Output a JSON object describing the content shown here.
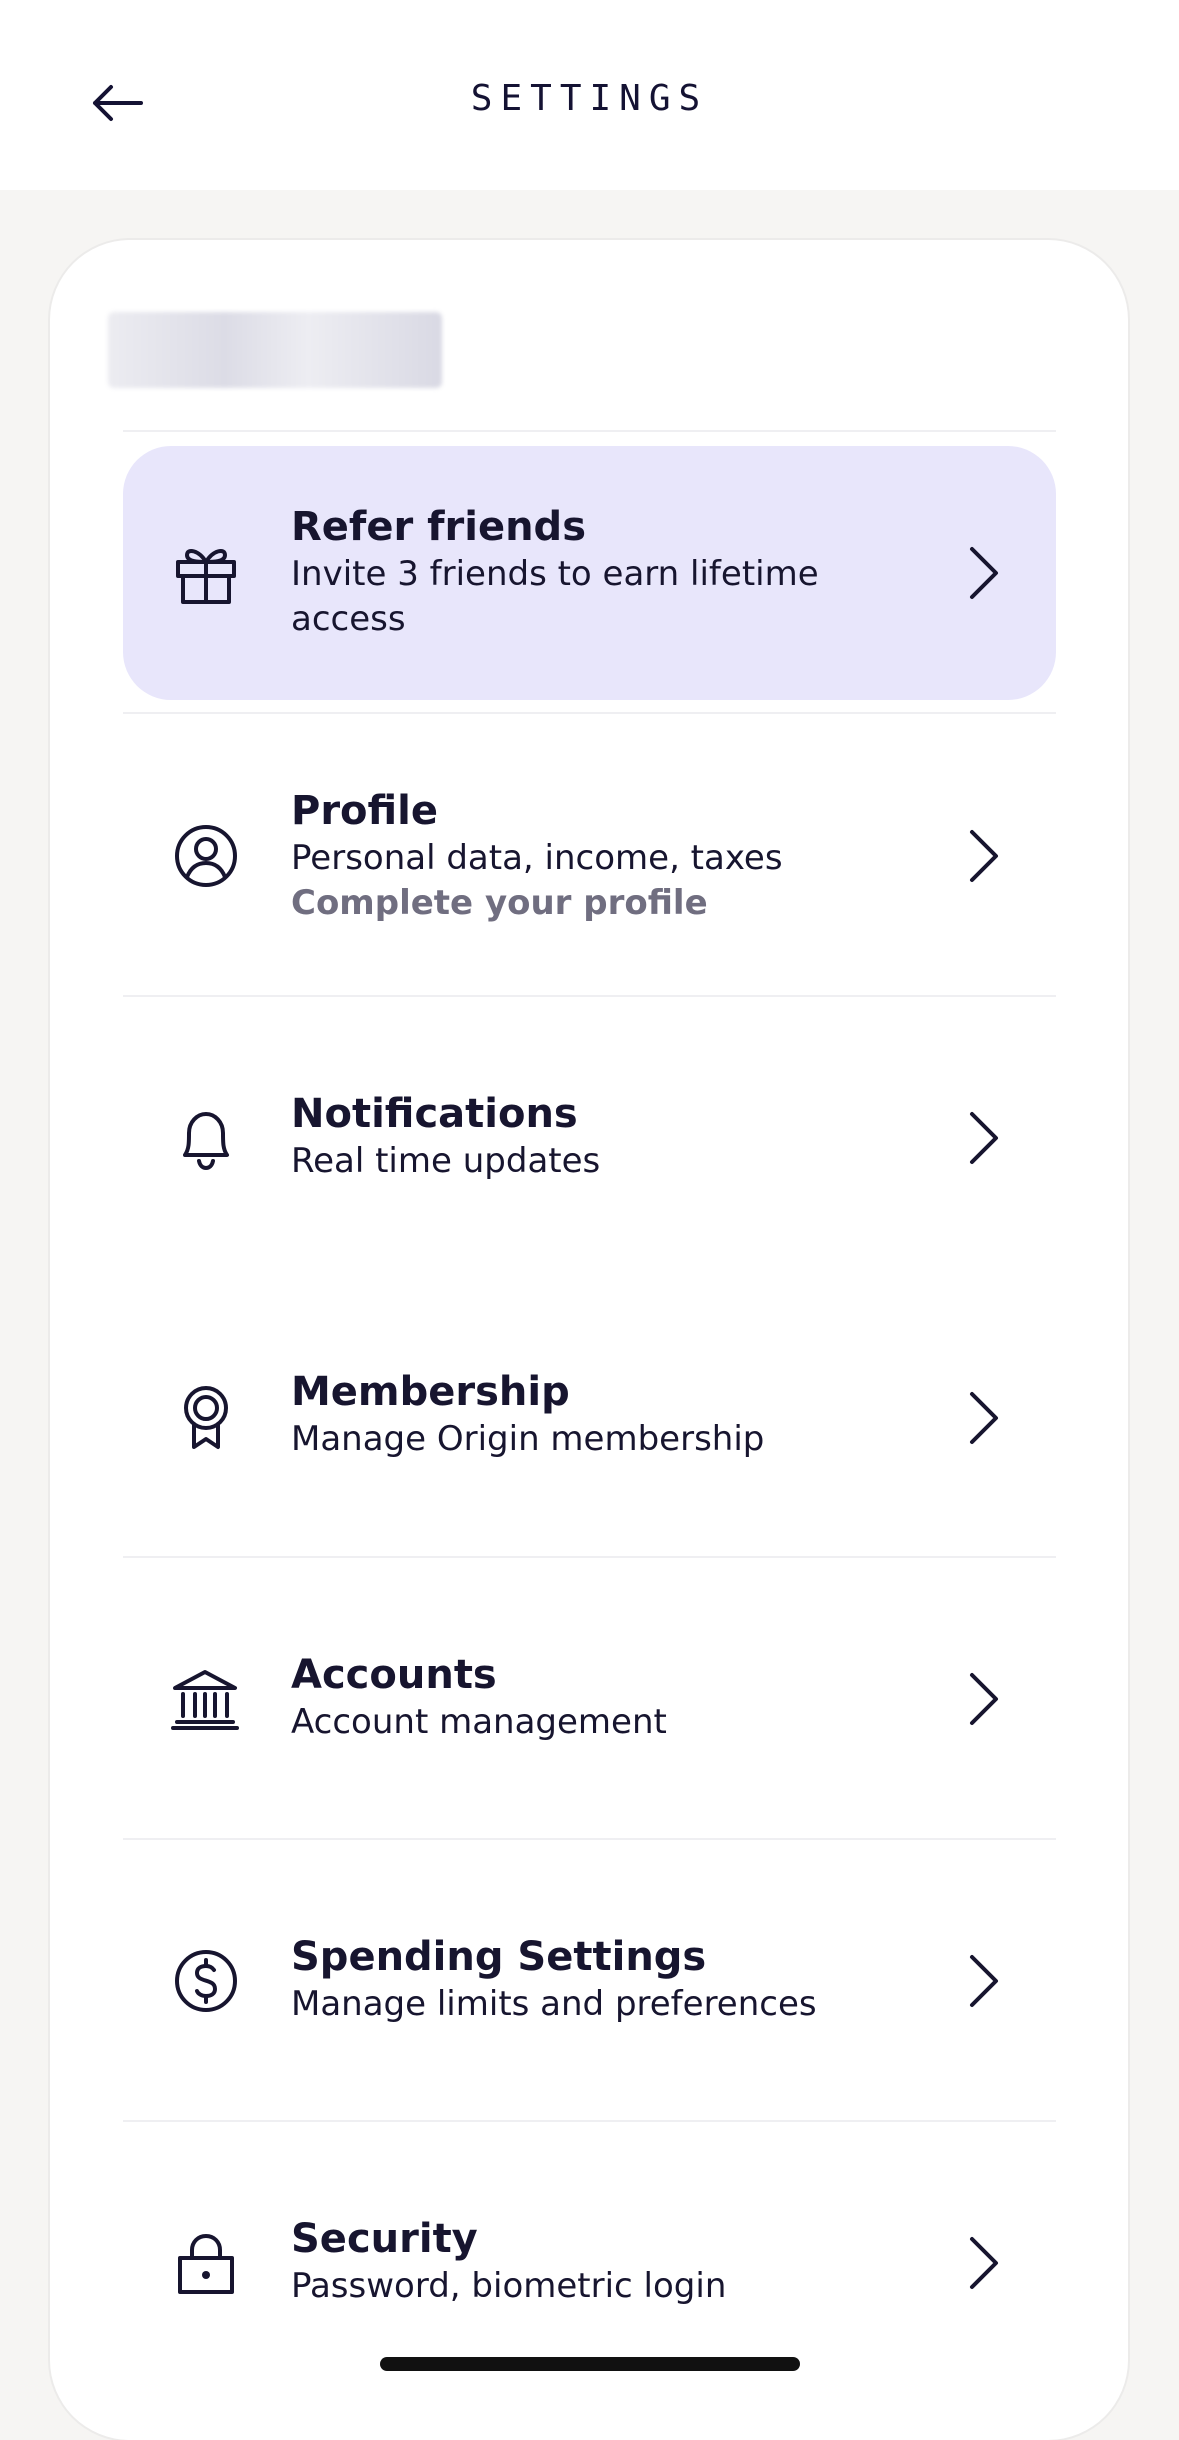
{
  "header": {
    "title": "SETTINGS"
  },
  "items": [
    {
      "title": "Refer friends",
      "subtitle": "Invite 3 friends to earn lifetime access",
      "icon": "gift-icon",
      "highlight_color": "#e8e6fb"
    },
    {
      "title": "Profile",
      "subtitle": "Personal data, income, taxes",
      "secondary": "Complete your profile",
      "icon": "user-circle-icon"
    },
    {
      "title": "Notifications",
      "subtitle": "Real time updates",
      "icon": "bell-icon"
    },
    {
      "title": "Membership",
      "subtitle": "Manage Origin membership",
      "icon": "award-ribbon-icon"
    },
    {
      "title": "Accounts",
      "subtitle": "Account management",
      "icon": "bank-icon"
    },
    {
      "title": "Spending Settings",
      "subtitle": "Manage limits and preferences",
      "icon": "dollar-circle-icon"
    },
    {
      "title": "Security",
      "subtitle": "Password, biometric login",
      "icon": "lock-icon"
    }
  ]
}
